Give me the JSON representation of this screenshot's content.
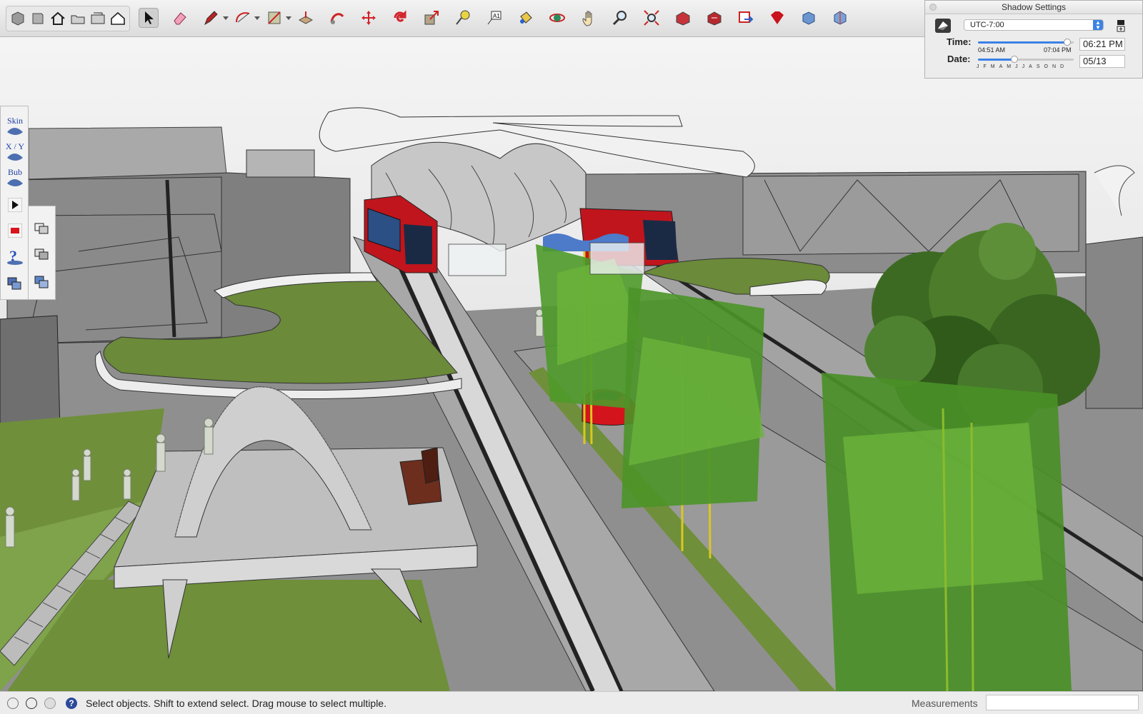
{
  "toolbar": {
    "tools": [
      "getting-started-icon",
      "warehouse-icon",
      "home-view-icon",
      "open-folder-icon",
      "save-icon",
      "house-outline-icon",
      "select-icon",
      "eraser-icon",
      "pencil-icon",
      "arc-icon",
      "rectangle-icon",
      "push-pull-icon",
      "follow-me-icon",
      "move-icon",
      "rotate-icon",
      "scale-icon",
      "tape-measure-icon",
      "text-icon",
      "paint-bucket-icon",
      "orbit-icon",
      "pan-icon",
      "zoom-icon",
      "zoom-extents-icon",
      "3d-warehouse-icon",
      "extension-warehouse-icon",
      "layout-icon",
      "ruby-icon",
      "component-icon",
      "style-icon"
    ]
  },
  "shadow_settings": {
    "title": "Shadow Settings",
    "timezone": "UTC-7:00",
    "time_label": "Time:",
    "date_label": "Date:",
    "sunrise": "04:51 AM",
    "sunset": "07:04 PM",
    "time_value": "06:21 PM",
    "date_value": "05/13",
    "time_slider_fraction": 0.93,
    "date_slider_fraction": 0.37,
    "months": [
      "J",
      "F",
      "M",
      "A",
      "M",
      "J",
      "J",
      "A",
      "S",
      "O",
      "N",
      "D"
    ]
  },
  "palette": {
    "skin_label": "Skin",
    "xy_label": "X / Y",
    "bub_label": "Bub"
  },
  "status": {
    "message": "Select objects. Shift to extend select. Drag mouse to select multiple.",
    "measurements_label": "Measurements",
    "measurements_value": ""
  },
  "colors": {
    "accent": "#3b82e6",
    "grass": "#6f8f3a",
    "tram_red": "#c0151c"
  }
}
